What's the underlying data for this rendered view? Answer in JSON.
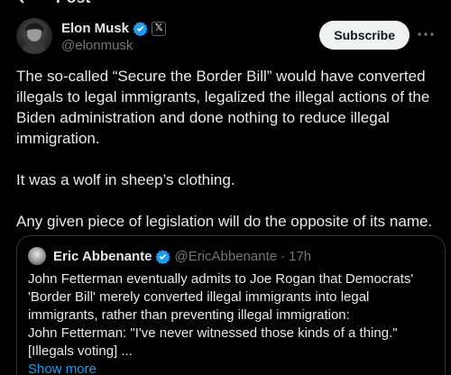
{
  "header": {
    "title_fragment": "Post"
  },
  "author": {
    "display_name": "Elon Musk",
    "handle": "@elonmusk",
    "affiliate_badge": "𝕏",
    "subscribe_label": "Subscribe"
  },
  "tweet": {
    "paragraphs": [
      "The so-called “Secure the Border Bill” would have converted illegals to legal immigrants, legalized the illegal actions of the Biden administration and done nothing to reduce illegal immigration.",
      "It was a wolf in sheep’s clothing.",
      "Any given piece of legislation will do the opposite of its name."
    ]
  },
  "quote": {
    "display_name": "Eric Abbenante",
    "handle": "@EricAbbenante",
    "separator": "·",
    "time": "17h",
    "lines": [
      "John Fetterman eventually admits to Joe Rogan that Democrats'",
      "'Border Bill' merely converted illegal immigrants into legal",
      "immigrants, rather than preventing illegal immigration:",
      "John Fetterman: \"I've never witnessed those kinds of a thing.\"",
      "[Illegals voting] ..."
    ],
    "show_more": "Show more"
  },
  "colors": {
    "background": "#000000",
    "text": "#e7e9ea",
    "secondary": "#71767b",
    "link": "#1d9bf0",
    "verified": "#1d9bf0",
    "border": "#2f3336"
  },
  "icons": {
    "back": "arrow-left-icon",
    "verified": "verified-badge-icon",
    "more": "more-icon"
  }
}
